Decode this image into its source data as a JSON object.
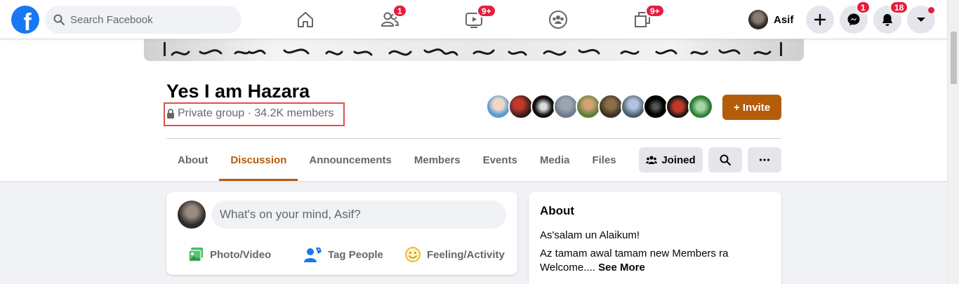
{
  "search": {
    "placeholder": "Search Facebook"
  },
  "nav": {
    "friends_badge": "1",
    "watch_badge": "9+",
    "gaming_badge": "9+"
  },
  "profile": {
    "name": "Asif"
  },
  "header_badges": {
    "messenger": "1",
    "notifications": "18"
  },
  "group": {
    "name": "Yes I am Hazara",
    "meta": "Private group · 34.2K members",
    "invite_label": "+ Invite"
  },
  "tabs": [
    {
      "label": "About"
    },
    {
      "label": "Discussion"
    },
    {
      "label": "Announcements"
    },
    {
      "label": "Members"
    },
    {
      "label": "Events"
    },
    {
      "label": "Media"
    },
    {
      "label": "Files"
    }
  ],
  "group_actions": {
    "joined_label": "Joined"
  },
  "composer": {
    "placeholder": "What's on your mind, Asif?",
    "photo_label": "Photo/Video",
    "tag_label": "Tag People",
    "feeling_label": "Feeling/Activity"
  },
  "about": {
    "title": "About",
    "line1": "As'salam un Alaikum!",
    "line2": "Az tamam awal tamam new Members ra Welcome....",
    "see_more": "See More"
  },
  "colors": {
    "accent": "#b35c0a",
    "brand": "#1877f2",
    "badge": "#e41e3f"
  },
  "icons": [
    "facebook-logo",
    "search-icon",
    "home-icon",
    "friends-icon",
    "watch-icon",
    "groups-icon",
    "gaming-icon",
    "plus-icon",
    "messenger-icon",
    "bell-icon",
    "caret-down-icon",
    "lock-icon",
    "joined-icon",
    "search-icon",
    "more-icon",
    "photo-icon",
    "tag-icon",
    "feeling-icon"
  ]
}
